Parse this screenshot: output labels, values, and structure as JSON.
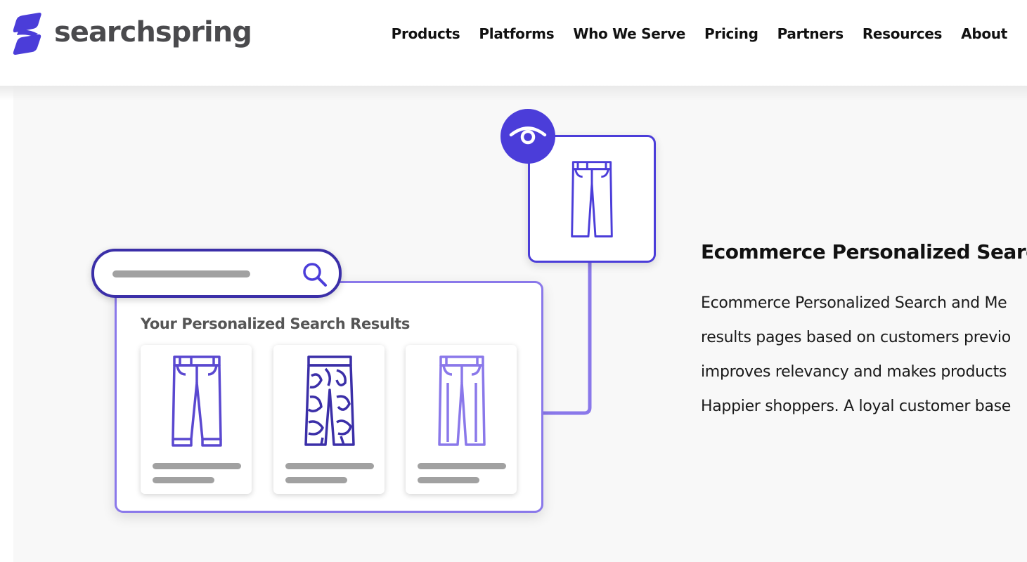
{
  "brand": {
    "name": "searchspring",
    "color": "#4b3dd9"
  },
  "nav": {
    "items": [
      "Products",
      "Platforms",
      "Who We Serve",
      "Pricing",
      "Partners",
      "Resources",
      "About"
    ]
  },
  "illustration": {
    "results_title": "Your Personalized Search Results",
    "icons": [
      "search-icon",
      "eye-icon",
      "pants-icon",
      "patterned-pants-icon"
    ]
  },
  "content": {
    "heading": "Ecommerce Personalized Search a",
    "paragraph_lines": [
      "Ecommerce Personalized Search and Me",
      "results pages based on customers previo",
      "improves relevancy and makes products",
      "Happier shoppers. A loyal customer base"
    ]
  }
}
